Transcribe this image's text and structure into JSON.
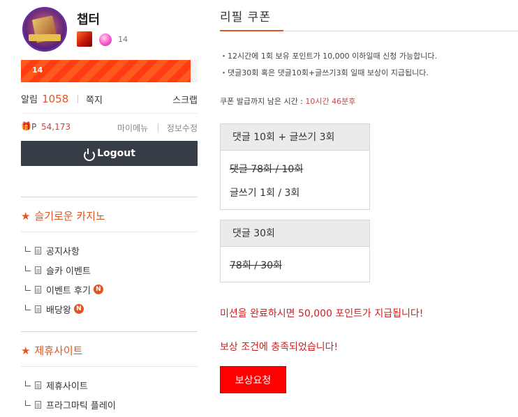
{
  "profile": {
    "nickname": "챕터",
    "level": "14",
    "exp_level": "14",
    "exp_progress": 0.96
  },
  "alarm": {
    "label": "알림",
    "count": "1058"
  },
  "note_label": "쪽지",
  "scrap_label": "스크랩",
  "point": {
    "label": "P",
    "value": "54,173"
  },
  "my_menu_label": "마이메뉴",
  "edit_info_label": "정보수정",
  "logout_label": "Logout",
  "sidebar": {
    "section1": {
      "title": "슬기로운 카지노",
      "items": [
        {
          "label": "공지사항",
          "new": false
        },
        {
          "label": "슬카 이벤트",
          "new": false
        },
        {
          "label": "이벤트 후기",
          "new": true,
          "badge": "N"
        },
        {
          "label": "배당왕",
          "new": true,
          "badge": "N"
        }
      ]
    },
    "section2": {
      "title": "제휴사이트",
      "items": [
        {
          "label": "제휴사이트"
        },
        {
          "label": "프라그마틱 플레이"
        }
      ]
    }
  },
  "main": {
    "title": "리필 쿠폰",
    "notices": [
      "12시간에 1회 보유 포인트가 10,000 이하일때 신청 가능합니다.",
      "댓글30회 혹은 댓글10회+글쓰기3회 일때 보상이 지급됩니다."
    ],
    "remain_label": "쿠폰 발급까지 남은 시간 : ",
    "remain_time": "10시간 46분후",
    "mission1": {
      "title": "댓글 10회 + 글쓰기 3회",
      "line1": "댓글 78회 / 10회",
      "line2": "글쓰기 1회 / 3회"
    },
    "mission2": {
      "title": "댓글 30회",
      "line1": "78회 / 30회"
    },
    "complete_message": "미션을 완료하시면 50,000 포인트가 지급됩니다!",
    "achieved_message": "보상 조건에 충족되었습니다!",
    "reward_button": "보상요청"
  },
  "colors": {
    "accent": "#e4541e",
    "reward_red": "#ff0000",
    "message_red": "#d01f1f",
    "logout_bg": "#363d47"
  }
}
